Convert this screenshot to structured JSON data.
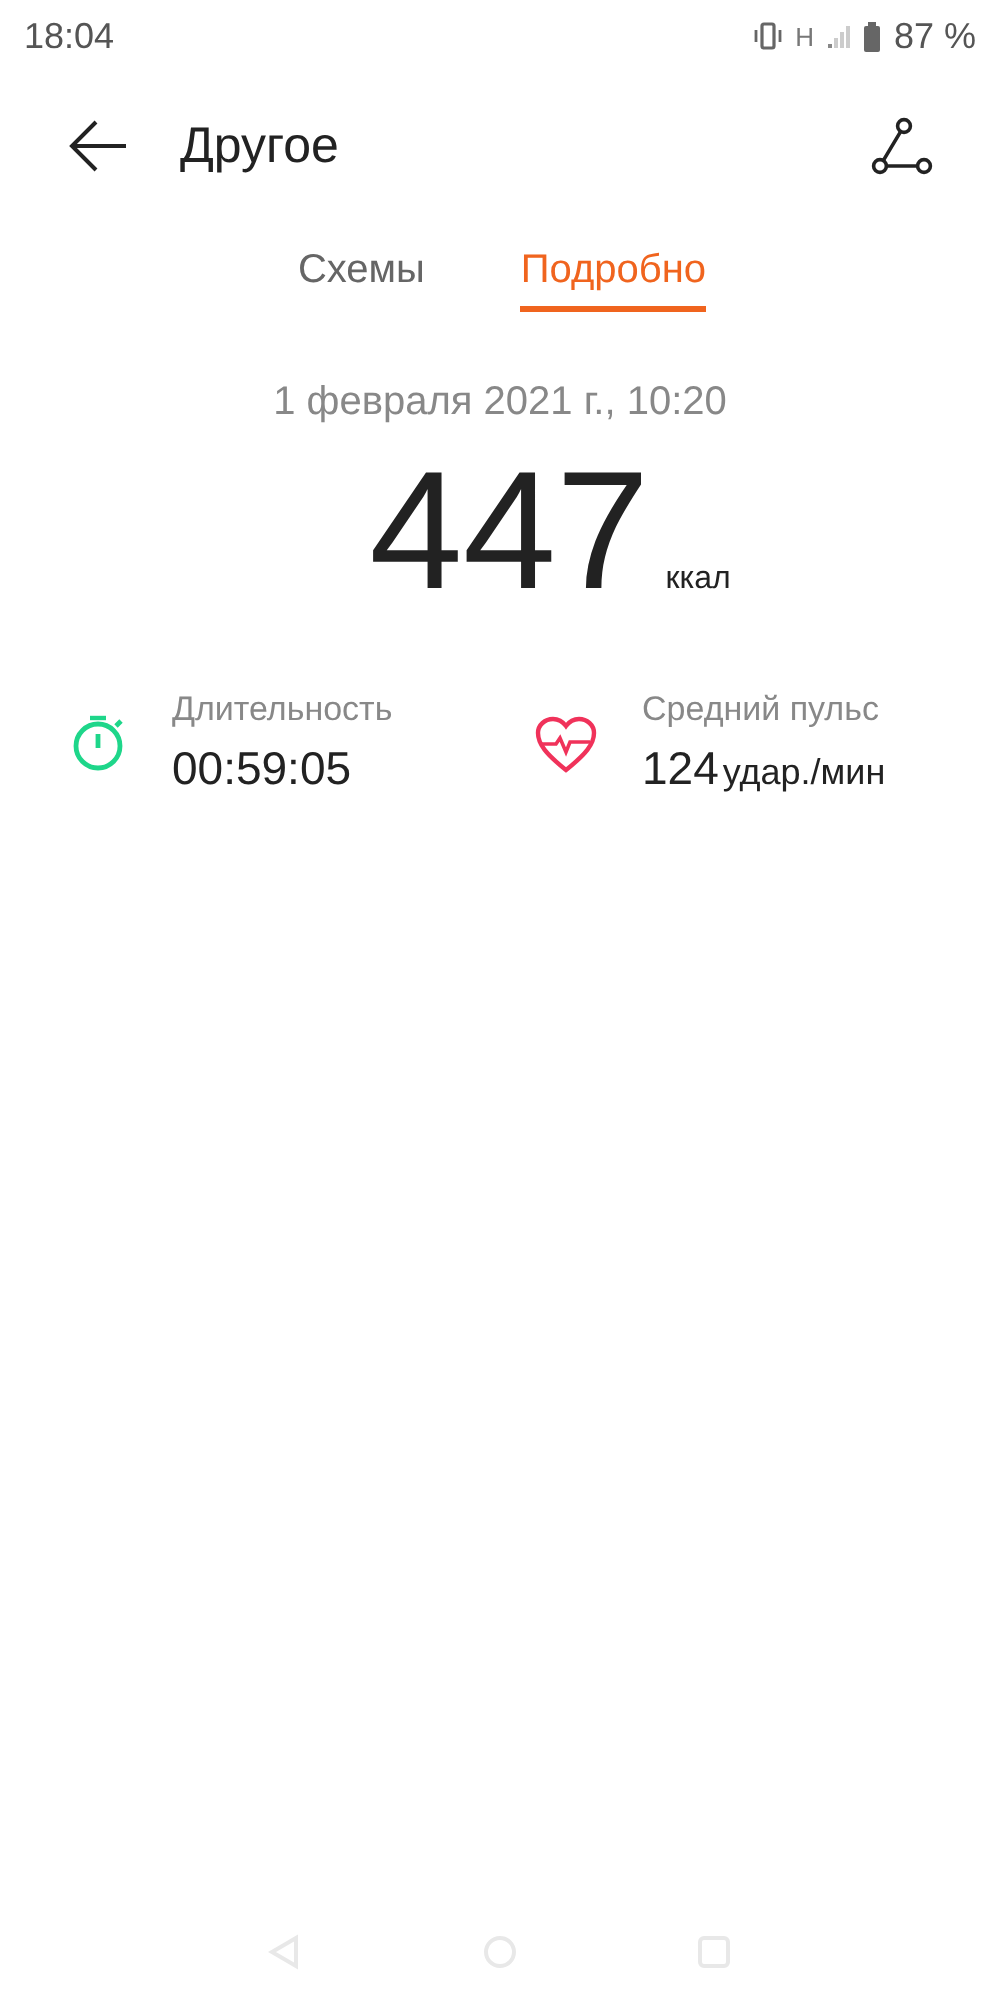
{
  "status_bar": {
    "time": "18:04",
    "network": "H",
    "battery": "87 %"
  },
  "header": {
    "title": "Другое"
  },
  "tabs": [
    {
      "label": "Схемы",
      "selected": false
    },
    {
      "label": "Подробно",
      "selected": true
    }
  ],
  "summary": {
    "date": "1 февраля 2021 г., 10:20",
    "value": "447",
    "unit": "ккал"
  },
  "stats": [
    {
      "kind": "duration",
      "label": "Длительность",
      "value": "00:59:05"
    },
    {
      "kind": "heart_rate",
      "label": "Средний пульс",
      "value": "124",
      "unit": "удар./мин"
    }
  ]
}
